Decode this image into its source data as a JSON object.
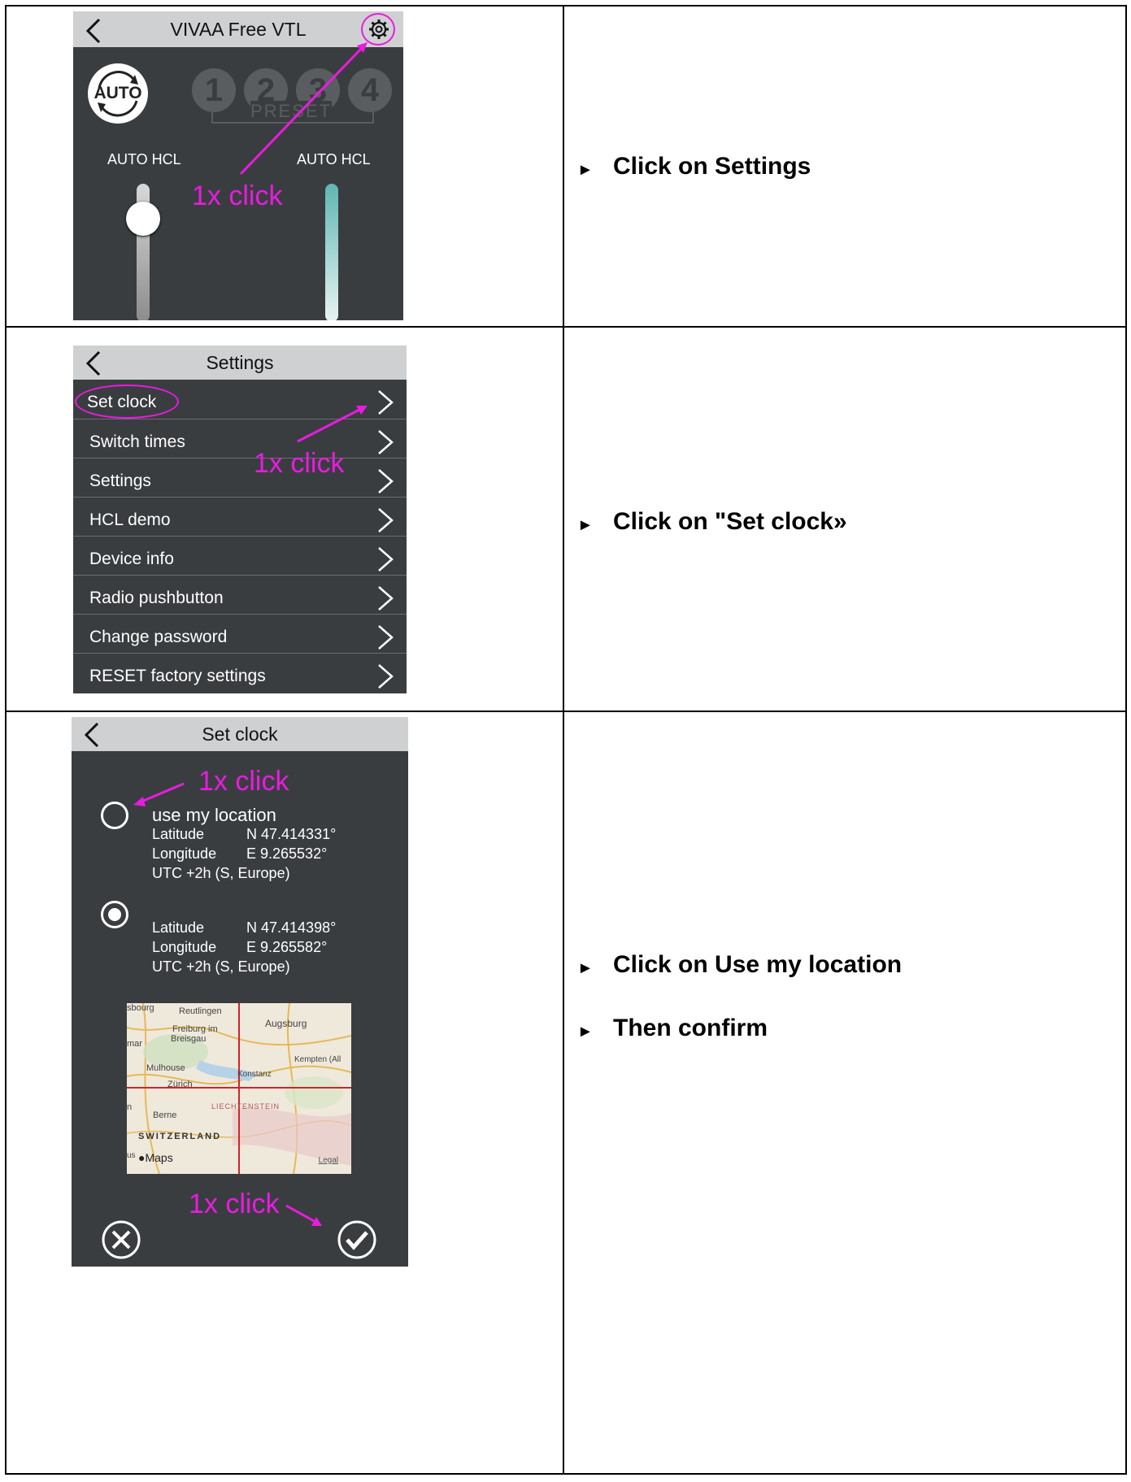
{
  "rows": [
    {
      "screen": {
        "title": "VIVAA Free VTL",
        "auto_label": "AUTO",
        "presets": [
          "1",
          "2",
          "3",
          "4"
        ],
        "preset_label": "PRESET",
        "left_slider_label": "AUTO HCL",
        "right_slider_label": "AUTO HCL",
        "annotation": "1x click"
      },
      "instructions": [
        "Click on Settings"
      ]
    },
    {
      "screen": {
        "title": "Settings",
        "menu": [
          "Set clock",
          "Switch times",
          "Settings",
          "HCL demo",
          "Device info",
          "Radio pushbutton",
          "Change password",
          "RESET factory settings"
        ],
        "annotation": "1x click"
      },
      "instructions": [
        "Click on \"Set clock»"
      ]
    },
    {
      "screen": {
        "title": "Set clock",
        "annotation_top": "1x click",
        "option1": {
          "label": "use my location",
          "lat_label": "Latitude",
          "lat_value": "N 47.414331°",
          "lon_label": "Longitude",
          "lon_value": "E 9.265532°",
          "tz": "UTC +2h  (S, Europe)"
        },
        "option2": {
          "lat_label": "Latitude",
          "lat_value": "N 47.414398°",
          "lon_label": "Longitude",
          "lon_value": "E 9.265582°",
          "tz": "UTC +2h  (S, Europe)"
        },
        "map": {
          "places": [
            "sbourg",
            "Reutlingen",
            "Augsburg",
            "Freiburg im",
            "Breisgau",
            "mar",
            "Kempten (All",
            "Mulhouse",
            "Konstanz",
            "Zürich",
            "LIECHTENSTEIN",
            "Berne",
            "SWITZERLAND",
            "n",
            "us"
          ],
          "brand": "Maps",
          "legal": "Legal"
        },
        "annotation_bottom": "1x click"
      },
      "instructions": [
        "Click on Use my location",
        "Then confirm"
      ]
    }
  ],
  "colors": {
    "annotation": "#e91be0",
    "screen_bg": "#3a3d40",
    "navbar_bg": "#cfd0d2"
  }
}
